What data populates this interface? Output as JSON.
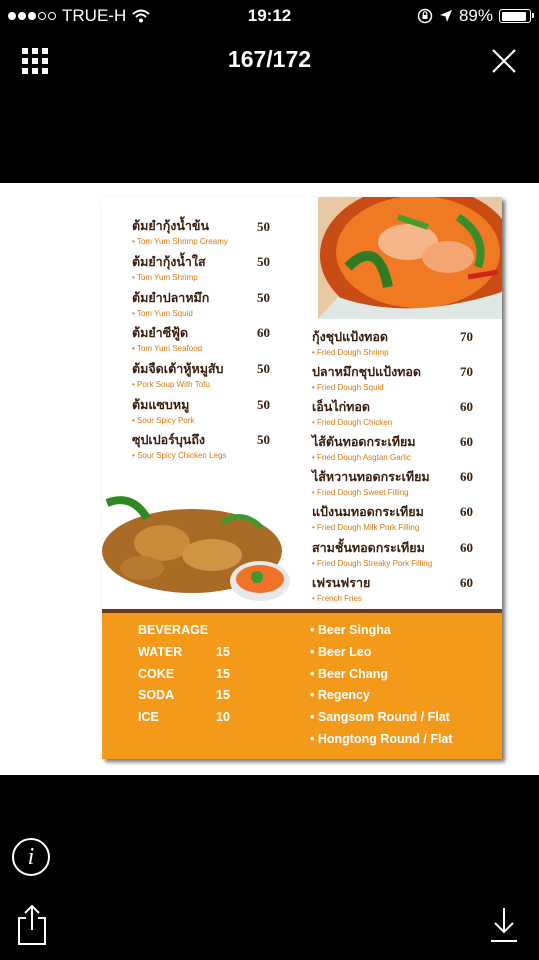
{
  "status_bar": {
    "carrier": "TRUE-H",
    "time": "19:12",
    "battery": "89%"
  },
  "nav": {
    "counter": "167/172"
  },
  "menu": {
    "left_items": [
      {
        "th": "ต้มยำกุ้งน้ำข้น",
        "en": "Tom Yum Shrimp Creamy",
        "price": "50"
      },
      {
        "th": "ต้มยำกุ้งน้ำใส",
        "en": "Tom Yum Shrimp",
        "price": "50"
      },
      {
        "th": "ต้มยำปลาหมึก",
        "en": "Tom Yum Squid",
        "price": "50"
      },
      {
        "th": "ต้มยำซีฟู้ด",
        "en": "Tom Yum Seafood",
        "price": "60"
      },
      {
        "th": "ต้มจืดเต้าหู้หมูสับ",
        "en": "Pork Soup With Tofu",
        "price": "50"
      },
      {
        "th": "ต้มแซบหมู",
        "en": "Sour Spicy Pork",
        "price": "50"
      },
      {
        "th": "ซุปเปอร์บุนถึง",
        "en": "Sour Spicy Chicken Legs",
        "price": "50"
      }
    ],
    "right_items": [
      {
        "th": "กุ้งชุปแป้งทอด",
        "en": "Fried Dough Shrimp",
        "price": "70"
      },
      {
        "th": "ปลาหมึกชุปแป้งทอด",
        "en": "Fried Dough Squid",
        "price": "70"
      },
      {
        "th": "เอ็นไก่ทอด",
        "en": "Fried Dough Chicken",
        "price": "60"
      },
      {
        "th": "ไส้ตันทอดกระเทียม",
        "en": "Fried Dough Asgtan Garlic",
        "price": "60"
      },
      {
        "th": "ไส้หวานทอดกระเทียม",
        "en": "Fried Dough Sweet Filling",
        "price": "60"
      },
      {
        "th": "แป้งนมทอดกระเทียม",
        "en": "Fried Dough Milk Pork Filling",
        "price": "60"
      },
      {
        "th": "สามชั้นทอดกระเทียม",
        "en": "Fried Dough Streaky Pork Filling",
        "price": "60"
      },
      {
        "th": "เฟรนฟราย",
        "en": "French Fries",
        "price": "60"
      }
    ],
    "beverage": {
      "heading": "BEVERAGE",
      "items": [
        {
          "name": "WATER",
          "price": "15"
        },
        {
          "name": "COKE",
          "price": "15"
        },
        {
          "name": "SODA",
          "price": "15"
        },
        {
          "name": "ICE",
          "price": "10"
        }
      ]
    },
    "beers": [
      "Beer Singha",
      "Beer Leo",
      "Beer Chang",
      "Regency",
      "Sangsom Round / Flat",
      "Hongtong Round / Flat"
    ]
  },
  "icons": [
    "grid-icon",
    "close-icon",
    "info-icon",
    "share-icon",
    "download-icon"
  ],
  "colors": {
    "orange": "#f39a1b",
    "dark_brown": "#3a1d0c",
    "accent_orange": "#d8780f"
  }
}
